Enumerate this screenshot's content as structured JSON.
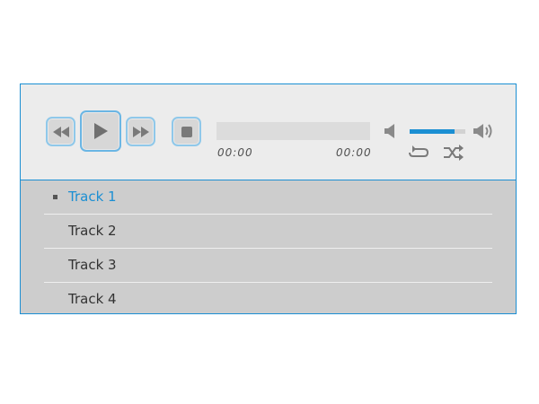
{
  "player": {
    "accent_color": "#1b8fd3",
    "controls": {
      "rewind_icon": "rewind-icon",
      "play_icon": "play-icon",
      "fast_forward_icon": "fast-forward-icon",
      "stop_icon": "stop-icon",
      "current_time": "00:00",
      "duration": "00:00",
      "progress_fraction": 0,
      "volume_fraction": 0.8,
      "mute_icon": "volume-mute-icon",
      "max_volume_icon": "volume-max-icon",
      "repeat_icon": "repeat-icon",
      "shuffle_icon": "shuffle-icon"
    },
    "playlist": {
      "active_index": 0,
      "tracks": [
        {
          "label": "Track 1"
        },
        {
          "label": "Track 2"
        },
        {
          "label": "Track 3"
        },
        {
          "label": "Track 4"
        }
      ]
    }
  }
}
